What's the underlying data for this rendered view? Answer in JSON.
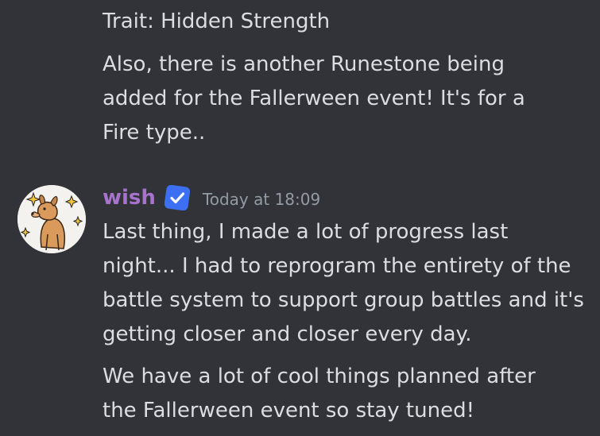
{
  "previous_message": {
    "paragraphs": [
      "Trait: Hidden Strength",
      "Also, there is another Runestone being added for the Fallerween event! It's for a Fire type.."
    ]
  },
  "message": {
    "author": "wish",
    "author_color": "#a872ce",
    "badge_icon": "verified-check-icon",
    "badge_color": "#3d6ff2",
    "timestamp": "Today at 18:09",
    "paragraphs": [
      "Last thing, I made a lot of progress last night... I had to reprogram the entirety of the battle system to support group battles and it's getting closer and closer every day.",
      "We have a lot of cool things planned after the Fallerween event so stay tuned!"
    ]
  },
  "colors": {
    "background": "#313338",
    "text": "#dbdee1",
    "timestamp": "#949ba4"
  }
}
